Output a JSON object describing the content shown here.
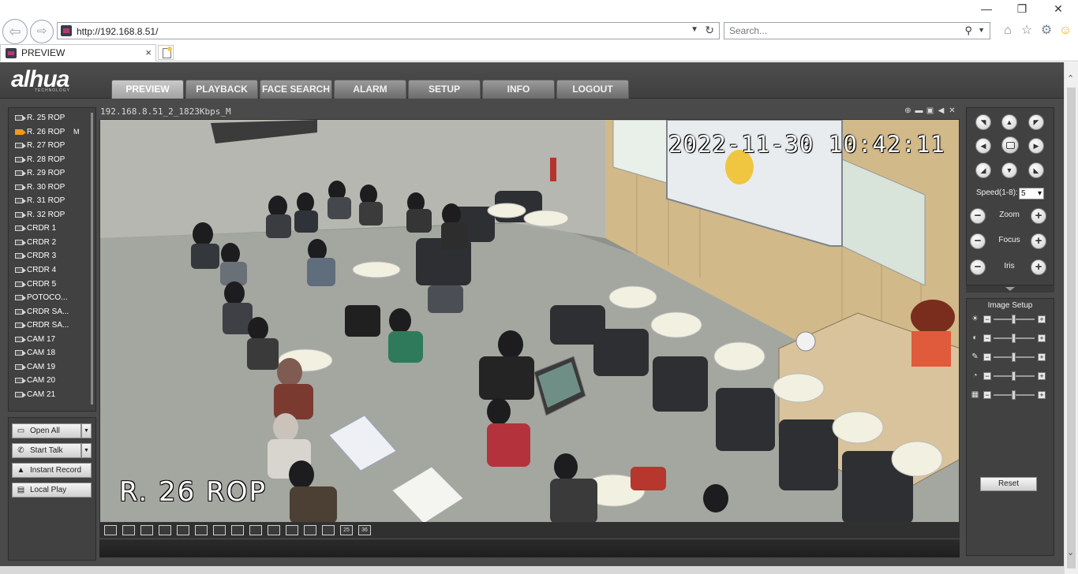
{
  "browser": {
    "window_controls": {
      "minimize": "—",
      "restore": "❐",
      "close": "✕"
    },
    "url": "http://192.168.8.51/",
    "search_placeholder": "Search...",
    "tab_title": "PREVIEW",
    "tab_close": "×"
  },
  "app": {
    "logo": "alhua",
    "logo_sub": "TECHNOLOGY",
    "nav_tabs": [
      {
        "label": "PREVIEW",
        "active": true
      },
      {
        "label": "PLAYBACK"
      },
      {
        "label": "FACE SEARCH"
      },
      {
        "label": "ALARM"
      },
      {
        "label": "SETUP"
      },
      {
        "label": "INFO"
      },
      {
        "label": "LOGOUT"
      }
    ]
  },
  "cameras": [
    {
      "label": "R. 25 ROP"
    },
    {
      "label": "R. 26 ROP",
      "badge": "M",
      "active": true
    },
    {
      "label": "R. 27 ROP"
    },
    {
      "label": "R. 28 ROP"
    },
    {
      "label": "R. 29 ROP"
    },
    {
      "label": "R. 30 ROP"
    },
    {
      "label": "R. 31 ROP"
    },
    {
      "label": "R. 32 ROP"
    },
    {
      "label": "CRDR 1"
    },
    {
      "label": "CRDR 2"
    },
    {
      "label": "CRDR 3"
    },
    {
      "label": "CRDR 4"
    },
    {
      "label": "CRDR 5"
    },
    {
      "label": "POTOCO..."
    },
    {
      "label": "CRDR SA..."
    },
    {
      "label": "CRDR SA..."
    },
    {
      "label": "CAM 17"
    },
    {
      "label": "CAM 18"
    },
    {
      "label": "CAM 19"
    },
    {
      "label": "CAM 20"
    },
    {
      "label": "CAM 21"
    }
  ],
  "actions": {
    "open_all": "Open All",
    "start_talk": "Start Talk",
    "instant_record": "Instant Record",
    "local_play": "Local Play"
  },
  "video": {
    "stream_info": "192.168.8.51_2_1823Kbps_M",
    "osd_datetime": "2022-11-30 10:42:11",
    "osd_channel": "R. 26 ROP",
    "layout_labels": [
      "",
      "",
      "",
      "",
      "",
      "",
      "",
      "",
      "",
      "",
      "",
      "",
      "",
      "25",
      "36"
    ]
  },
  "ptz": {
    "speed_label": "Speed(1-8):",
    "speed_value": "5",
    "zoom_label": "Zoom",
    "focus_label": "Focus",
    "iris_label": "Iris"
  },
  "image_setup": {
    "title": "Image Setup",
    "levels": [
      0.5,
      0.5,
      0.5,
      0.5,
      0.5
    ],
    "reset_label": "Reset"
  }
}
